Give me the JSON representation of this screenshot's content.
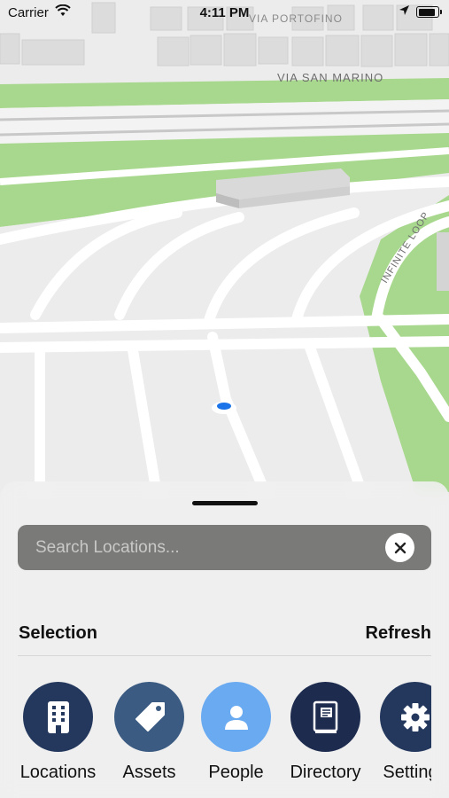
{
  "status_bar": {
    "carrier": "Carrier",
    "time": "4:11 PM",
    "battery_level": 0.95,
    "icons": [
      "wifi-icon",
      "location-arrow-icon",
      "battery-icon"
    ]
  },
  "map": {
    "street_labels": [
      "VIA PORTOFINO",
      "VIA SAN MARINO",
      "INFINITE LOOP"
    ],
    "user_location_color": "#1a73e8"
  },
  "sheet": {
    "search": {
      "placeholder": "Search Locations...",
      "value": ""
    },
    "section_title": "Selection",
    "refresh_label": "Refresh",
    "categories": [
      {
        "label": "Locations",
        "icon": "building-icon",
        "color": "#24385e"
      },
      {
        "label": "Assets",
        "icon": "tag-icon",
        "color": "#3b5b82"
      },
      {
        "label": "People",
        "icon": "person-icon",
        "color": "#6aaaf1"
      },
      {
        "label": "Directory",
        "icon": "book-icon",
        "color": "#1d2b4f"
      },
      {
        "label": "Settings",
        "icon": "gear-icon",
        "color": "#24385e"
      }
    ]
  },
  "colors": {
    "grass": "#a8d88d",
    "road": "#ffffff",
    "ground": "#ececec"
  }
}
